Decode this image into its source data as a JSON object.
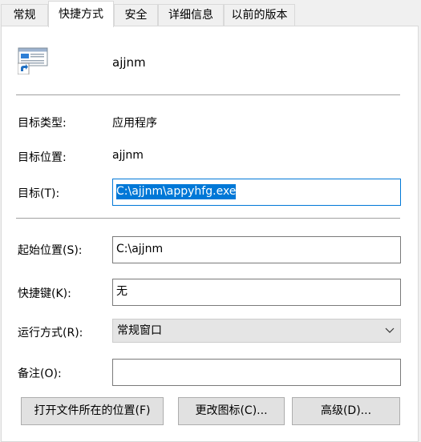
{
  "tabs": [
    {
      "label": "常规",
      "active": false
    },
    {
      "label": "快捷方式",
      "active": true
    },
    {
      "label": "安全",
      "active": false
    },
    {
      "label": "详细信息",
      "active": false
    },
    {
      "label": "以前的版本",
      "active": false
    }
  ],
  "header": {
    "icon": "application-shortcut-icon",
    "name": "ajjnm"
  },
  "fields": {
    "target_type": {
      "label": "目标类型:",
      "value": "应用程序"
    },
    "target_location": {
      "label": "目标位置:",
      "value": "ajjnm"
    },
    "target": {
      "label": "目标(T):",
      "value": "C:\\ajjnm\\appyhfg.exe"
    },
    "start_in": {
      "label": "起始位置(S):",
      "value": "C:\\ajjnm"
    },
    "shortcut_key": {
      "label": "快捷键(K):",
      "value": "无"
    },
    "run": {
      "label": "运行方式(R):",
      "value": "常规窗口"
    },
    "comment": {
      "label": "备注(O):",
      "value": ""
    }
  },
  "buttons": {
    "open_location": "打开文件所在的位置(F)",
    "change_icon": "更改图标(C)...",
    "advanced": "高级(D)..."
  },
  "colors": {
    "accent": "#0078d7",
    "window_bg": "#f0f0f0",
    "panel_bg": "#ffffff"
  }
}
